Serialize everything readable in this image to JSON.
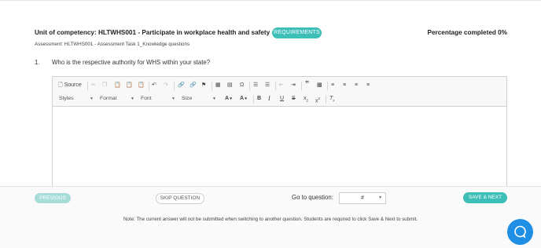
{
  "header": {
    "unit_title": "Unit of competency: HLTWHS001 - Participate in workplace health and safety -HLT",
    "requirements_label": "REQUIREMENTS",
    "percentage": "Percentage completed 0%",
    "assessment": "Assessment: HLTWHS001 - Assessment Task 1_Knowledge questions"
  },
  "question": {
    "number": "1.",
    "text": "Who is the respective authority for WHS within your state?"
  },
  "editor": {
    "source_label": "Source",
    "styles_label": "Styles",
    "format_label": "Format",
    "font_label": "Font",
    "size_label": "Size",
    "content": ""
  },
  "footer": {
    "previous_label": "PREVIOUS",
    "skip_label": "SKIP QUESTION",
    "goto_label": "Go to question:",
    "goto_value": "#",
    "next_label": "SAVE & NEXT",
    "note": "Note: The current answer will not be submitted when switching to another question. Students are required to click Save & Next to submit."
  },
  "colors": {
    "accent": "#3dbeb7",
    "accent_disabled": "#a7dcd8",
    "chat": "#1e8fe5"
  }
}
